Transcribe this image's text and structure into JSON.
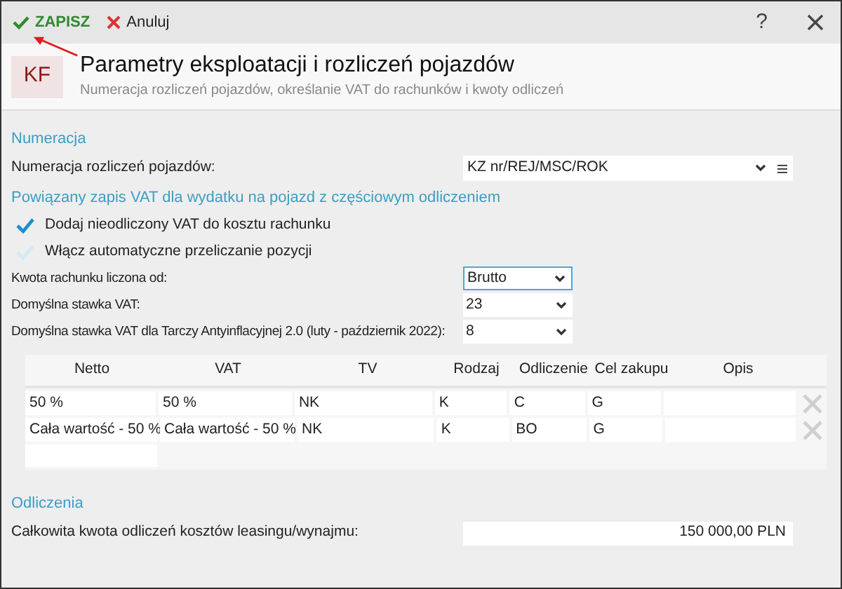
{
  "toolbar": {
    "buttons": [
      {
        "kind": "save",
        "label": "ZAPISZ"
      },
      {
        "kind": "cancel",
        "label": "Anuluj"
      }
    ],
    "help": "?"
  },
  "header": {
    "badge": "KF",
    "title": "Parametry eksploatacji i rozliczeń pojazdów",
    "subtitle": "Numeracja rozliczeń pojazdów, określanie VAT do rachunków i kwoty odliczeń"
  },
  "sections": [
    {
      "title": "Numeracja",
      "items": [
        {
          "kind": "combo",
          "label": "Numeracja rozliczeń pojazdów:",
          "value": "KZ nr/REJ/MSC/ROK"
        }
      ]
    },
    {
      "title": "Powiązany zapis VAT dla wydatku na pojazd z częściowym odliczeniem",
      "items": [
        {
          "kind": "checkbox",
          "label": "Dodaj nieodliczony VAT do kosztu rachunku",
          "checked": true
        },
        {
          "kind": "checkbox",
          "label": "Włącz automatyczne przeliczanie pozycji",
          "checked": false
        },
        {
          "kind": "select",
          "label": "Kwota rachunku liczona od:",
          "value": "Brutto",
          "focused": true
        },
        {
          "kind": "select",
          "label": "Domyślna stawka VAT:",
          "value": "23",
          "focused": false
        },
        {
          "kind": "select",
          "label": "Domyślna stawka VAT dla Tarczy Antyinflacyjnej 2.0 (luty - październik 2022):",
          "value": "8",
          "focused": false
        },
        {
          "kind": "table",
          "columns": [
            "Netto",
            "VAT",
            "TV",
            "Rodzaj",
            "Odliczenie",
            "Cel zakupu",
            "Opis"
          ],
          "rows": [
            [
              "50 %",
              "50 %",
              "NK",
              "K",
              "C",
              "G"
            ],
            [
              "Cała wartość - 50 %",
              "Cała wartość - 50 %",
              "NK",
              "K",
              "BO",
              "G"
            ]
          ]
        }
      ]
    },
    {
      "title": "Odliczenia",
      "items": [
        {
          "kind": "amount",
          "label": "Całkowita kwota odliczeń kosztów leasingu/wynajmu:",
          "value": "150 000,00 PLN"
        }
      ]
    }
  ]
}
